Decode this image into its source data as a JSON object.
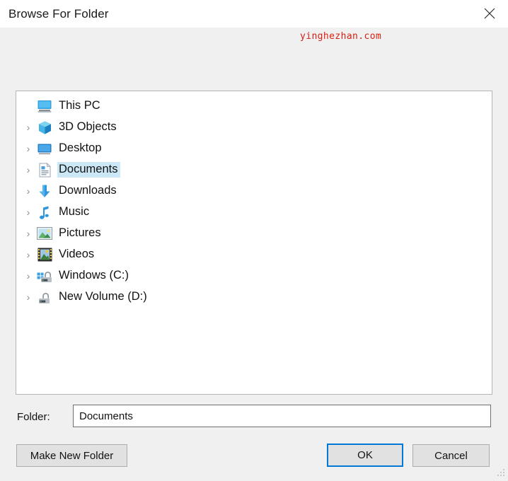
{
  "window": {
    "title": "Browse For Folder",
    "close_icon": "close-icon"
  },
  "watermark": {
    "text": "yinghezhan.com",
    "color": "#d91f11"
  },
  "tree": {
    "items": [
      {
        "label": "This PC",
        "icon": "monitor-icon",
        "expandable": false,
        "selected": false,
        "indent": 0
      },
      {
        "label": "3D Objects",
        "icon": "cube-icon",
        "expandable": true,
        "selected": false,
        "indent": 1
      },
      {
        "label": "Desktop",
        "icon": "desktop-icon",
        "expandable": true,
        "selected": false,
        "indent": 1
      },
      {
        "label": "Documents",
        "icon": "document-icon",
        "expandable": true,
        "selected": true,
        "indent": 1
      },
      {
        "label": "Downloads",
        "icon": "download-arrow-icon",
        "expandable": true,
        "selected": false,
        "indent": 1
      },
      {
        "label": "Music",
        "icon": "music-note-icon",
        "expandable": true,
        "selected": false,
        "indent": 1
      },
      {
        "label": "Pictures",
        "icon": "picture-icon",
        "expandable": true,
        "selected": false,
        "indent": 1
      },
      {
        "label": "Videos",
        "icon": "film-strip-icon",
        "expandable": true,
        "selected": false,
        "indent": 1
      },
      {
        "label": "Windows (C:)",
        "icon": "windows-drive-icon",
        "expandable": true,
        "selected": false,
        "indent": 1
      },
      {
        "label": "New Volume (D:)",
        "icon": "drive-icon",
        "expandable": true,
        "selected": false,
        "indent": 1
      }
    ],
    "selection_color": "#cce8f7",
    "chevron_glyph": "›"
  },
  "folder_field": {
    "label": "Folder:",
    "value": "Documents",
    "placeholder": ""
  },
  "buttons": {
    "make_new_folder": "Make New Folder",
    "ok": "OK",
    "cancel": "Cancel",
    "focus_color": "#0078d7"
  }
}
